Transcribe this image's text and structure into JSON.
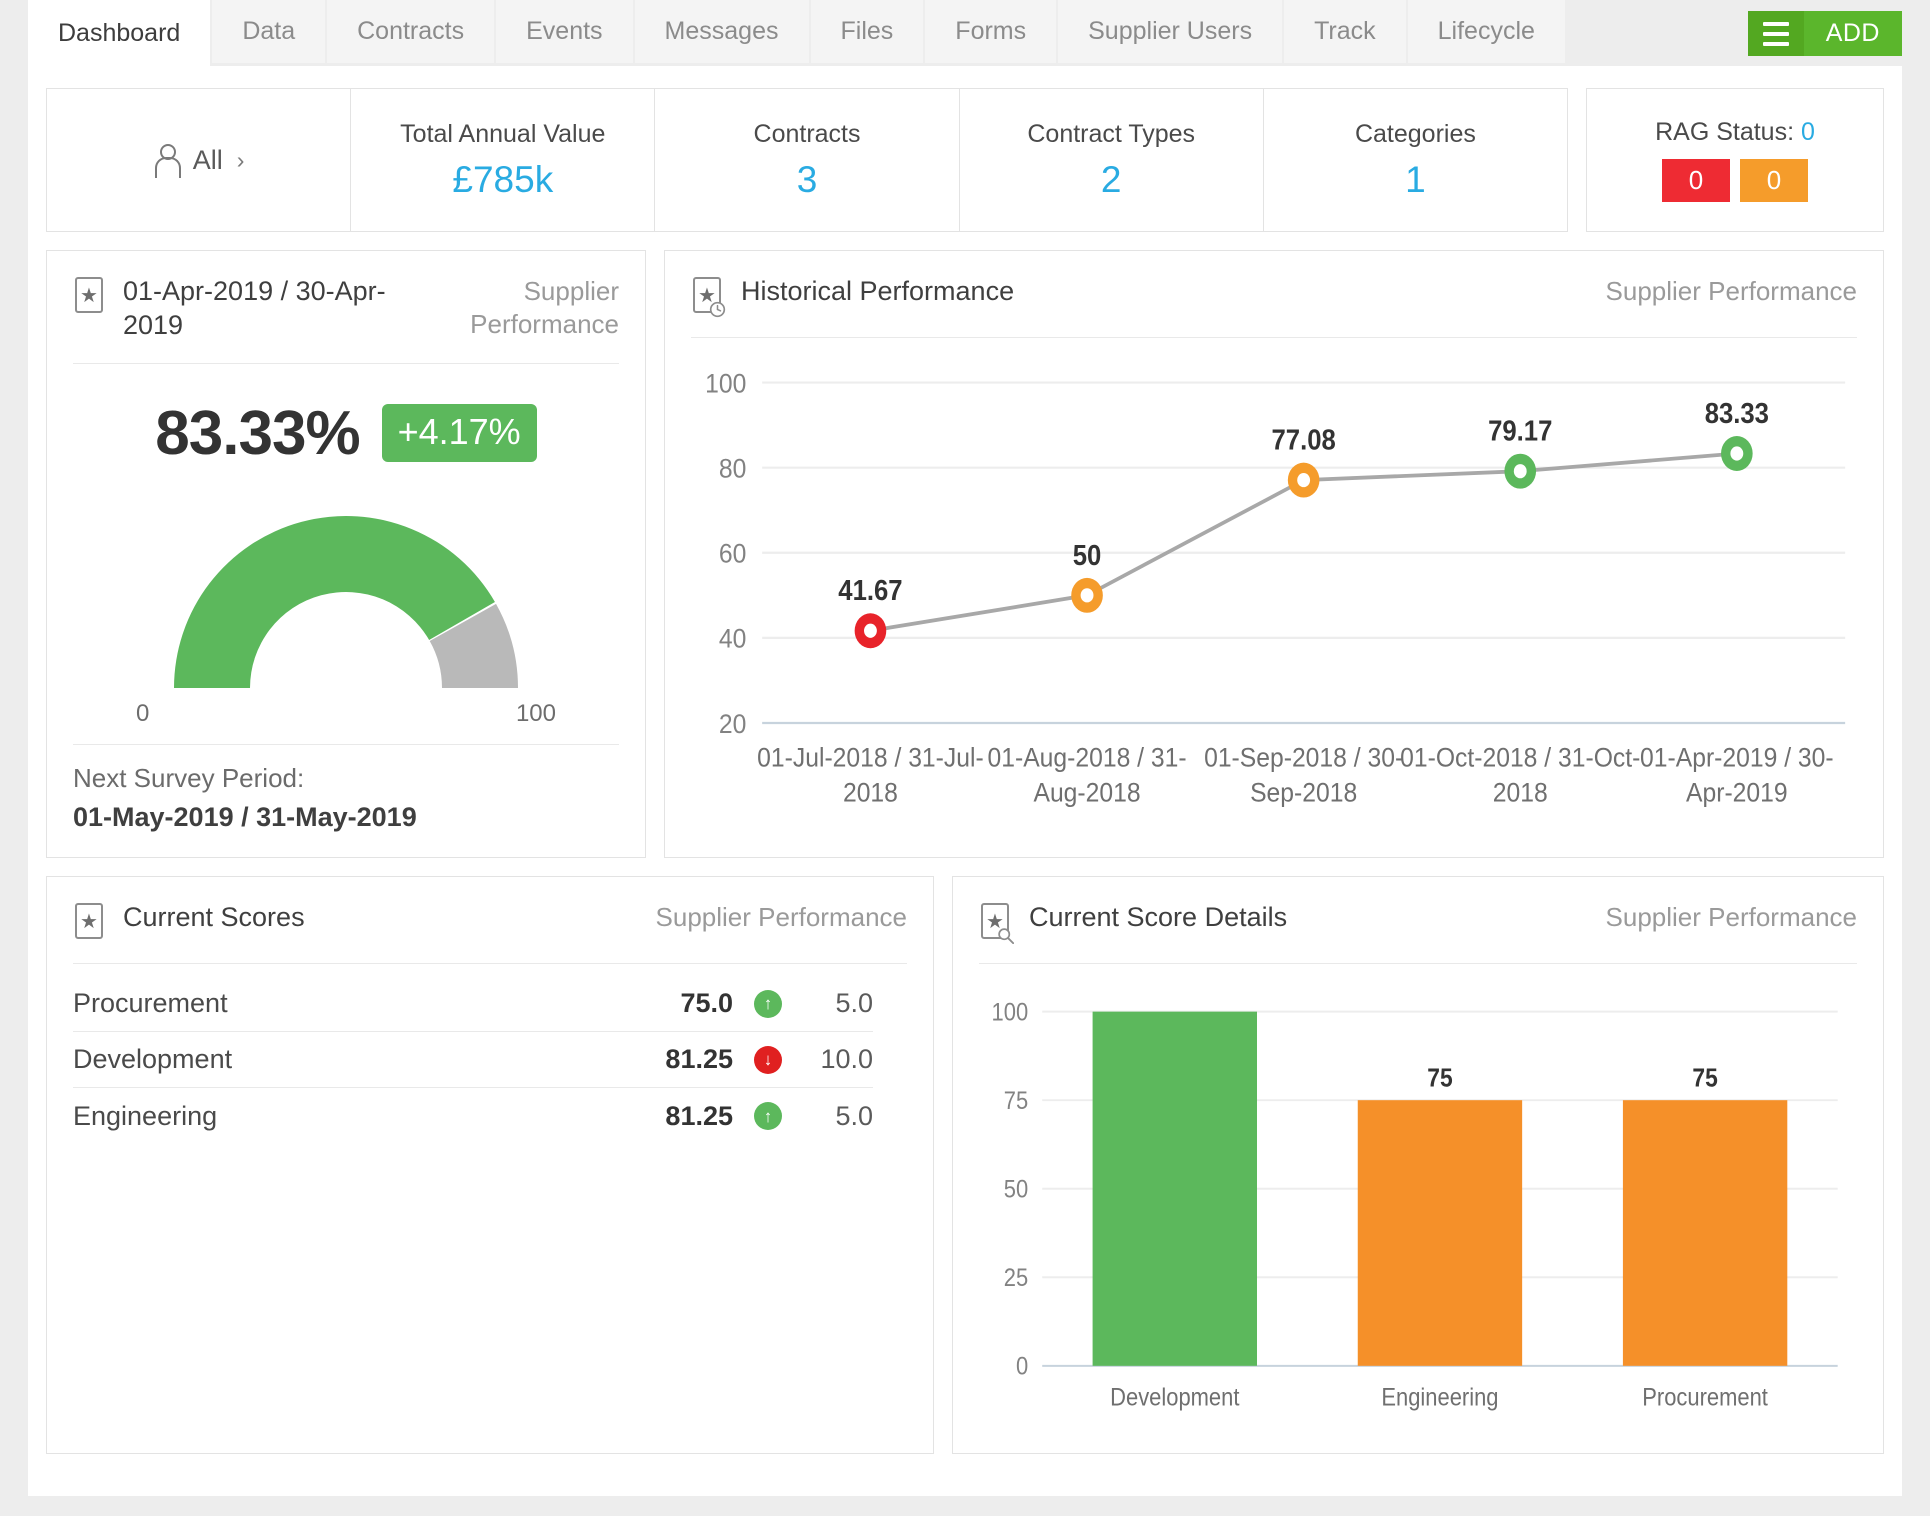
{
  "tabs": [
    {
      "label": "Dashboard",
      "active": true
    },
    {
      "label": "Data",
      "active": false
    },
    {
      "label": "Contracts",
      "active": false
    },
    {
      "label": "Events",
      "active": false
    },
    {
      "label": "Messages",
      "active": false
    },
    {
      "label": "Files",
      "active": false
    },
    {
      "label": "Forms",
      "active": false
    },
    {
      "label": "Supplier Users",
      "active": false
    },
    {
      "label": "Track",
      "active": false
    },
    {
      "label": "Lifecycle",
      "active": false
    }
  ],
  "toolbar": {
    "menu_icon": "hamburger-icon",
    "add_label": "ADD",
    "add_color": "#5bb62c"
  },
  "kpis": {
    "filter": {
      "icon": "person-icon",
      "label": "All",
      "chevron": "›"
    },
    "cells": [
      {
        "label": "Total Annual Value",
        "value": "£785k"
      },
      {
        "label": "Contracts",
        "value": "3"
      },
      {
        "label": "Contract Types",
        "value": "2"
      },
      {
        "label": "Categories",
        "value": "1"
      }
    ],
    "value_color": "#29abe2",
    "rag": {
      "label_prefix": "RAG Status: ",
      "label_value": "0",
      "chips": [
        {
          "value": "0",
          "color": "#ee2b33"
        },
        {
          "value": "0",
          "color": "#f59c2b"
        }
      ]
    }
  },
  "gauge_card": {
    "icon": "star-document-icon",
    "title": "01-Apr-2019 / 30-Apr-2019",
    "subtitle": "Supplier Performance",
    "score": "83.33%",
    "delta": "+4.17%",
    "delta_color": "#5cb85c",
    "scale_min": "0",
    "scale_max": "100",
    "next_survey_label": "Next Survey Period:",
    "next_survey_value": "01-May-2019 / 31-May-2019"
  },
  "historical_card": {
    "icon": "star-clock-icon",
    "title": "Historical Performance",
    "subtitle": "Supplier Performance"
  },
  "scores_card": {
    "icon": "star-document-icon",
    "title": "Current Scores",
    "subtitle": "Supplier Performance",
    "rows": [
      {
        "name": "Procurement",
        "score": "75.0",
        "direction": "up",
        "change": "5.0"
      },
      {
        "name": "Development",
        "score": "81.25",
        "direction": "down",
        "change": "10.0"
      },
      {
        "name": "Engineering",
        "score": "81.25",
        "direction": "up",
        "change": "5.0"
      }
    ]
  },
  "details_card": {
    "icon": "star-search-icon",
    "title": "Current Score Details",
    "subtitle": "Supplier Performance"
  },
  "chart_data": [
    {
      "id": "gauge",
      "type": "pie",
      "title": "Supplier Performance Gauge",
      "value": 83.33,
      "min": 0,
      "max": 100,
      "tick_labels": [
        "0",
        "100"
      ],
      "colors": {
        "filled": "#5cb85c",
        "empty": "#b9b9b9"
      },
      "start_angle": 180,
      "end_angle": 360
    },
    {
      "id": "historical-performance",
      "type": "line",
      "title": "Historical Performance",
      "xlabel": "",
      "ylabel": "",
      "ylim": [
        20,
        100
      ],
      "yticks": [
        20,
        40,
        60,
        80,
        100
      ],
      "grid": true,
      "legend": "none",
      "line_color": "#a8a8a8",
      "categories": [
        "01-Jul-2018 / 31-Jul-2018",
        "01-Aug-2018 / 31-Aug-2018",
        "01-Sep-2018 / 30-Sep-2018",
        "01-Oct-2018 / 31-Oct-2018",
        "01-Apr-2019 / 30-Apr-2019"
      ],
      "values": [
        41.67,
        50,
        77.08,
        79.17,
        83.33
      ],
      "point_labels": [
        "41.67",
        "50",
        "77.08",
        "79.17",
        "83.33"
      ],
      "point_colors": [
        "#e8232a",
        "#f59c2b",
        "#f59c2b",
        "#5cb85c",
        "#5cb85c"
      ]
    },
    {
      "id": "current-score-details",
      "type": "bar",
      "title": "Current Score Details",
      "xlabel": "",
      "ylabel": "",
      "ylim": [
        0,
        100
      ],
      "yticks": [
        0,
        25,
        50,
        75,
        100
      ],
      "grid": true,
      "legend": "none",
      "categories": [
        "Development",
        "Engineering",
        "Procurement"
      ],
      "values": [
        100,
        75,
        75
      ],
      "bar_labels": [
        "",
        "75",
        "75"
      ],
      "bar_colors": [
        "#5cb85c",
        "#f59029",
        "#f59029"
      ]
    }
  ]
}
